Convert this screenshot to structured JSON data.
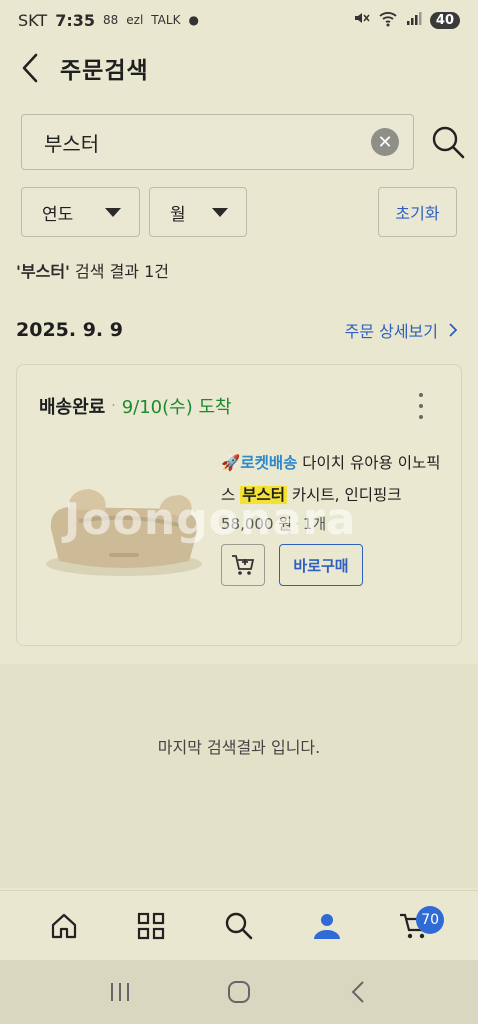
{
  "status_bar": {
    "carrier": "SKT",
    "time": "7:35",
    "icons": [
      "88-icon",
      "ezl-icon",
      "talk-icon",
      "dot-icon"
    ],
    "right_icons": [
      "mute-icon",
      "wifi-icon",
      "signal-icon"
    ],
    "battery": "40"
  },
  "header": {
    "title": "주문검색"
  },
  "search": {
    "value": "부스터",
    "placeholder": ""
  },
  "filters": {
    "year": "연도",
    "month": "월",
    "reset": "초기화"
  },
  "result_summary": {
    "query": "'부스터'",
    "text": " 검색 결과 1건"
  },
  "order": {
    "date": "2025. 9. 9",
    "detail_link": "주문 상세보기",
    "status": "배송완료",
    "arrival": "9/10(수) 도착",
    "product": {
      "badge": "로켓배송",
      "name_before": " 다이치 유아용 이노픽스 ",
      "highlight": "부스터",
      "name_after": " 카시트, 인디핑크",
      "price": "58,000 원",
      "quantity": "1개",
      "buy_label": "바로구매"
    }
  },
  "watermark": "Joongonara",
  "end_message": "마지막 검색결과 입니다.",
  "bottom_nav": {
    "items": [
      "home-icon",
      "category-icon",
      "search-icon",
      "my-icon",
      "cart-icon"
    ],
    "cart_count": "70"
  },
  "colors": {
    "background": "#e9e7cf",
    "accent": "#2f5fbf",
    "arrival": "#1e8a2f",
    "highlight": "#f3e234"
  }
}
